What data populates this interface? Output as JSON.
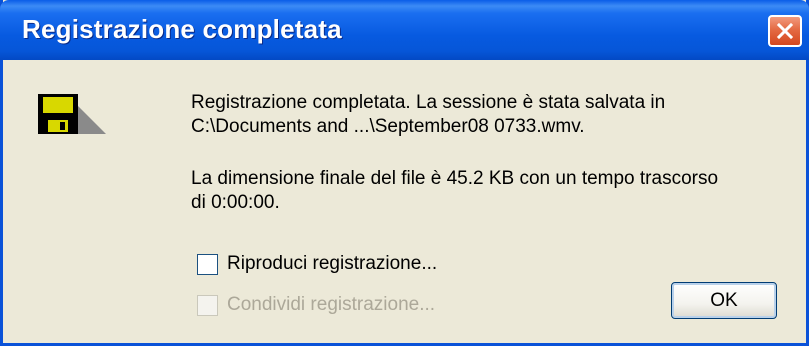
{
  "window": {
    "title": "Registrazione completata"
  },
  "icons": {
    "close": "close-icon",
    "save": "floppy-disk-icon"
  },
  "message": {
    "line1": "Registrazione completata. La sessione è stata salvata in",
    "line2": "C:\\Documents and ...\\September08 0733.wmv.",
    "line3": "La dimensione finale del file è 45.2 KB con un tempo trascorso",
    "line4": "di 0:00:00."
  },
  "options": {
    "play_label": "Riproduci registrazione...",
    "play_checked": false,
    "share_label": "Condividi registrazione...",
    "share_checked": false,
    "share_enabled": false
  },
  "buttons": {
    "ok_label": "OK"
  },
  "colors": {
    "titlebar": "#0a5de8",
    "close_button": "#e46a43",
    "dialog_background": "#ece9d8"
  }
}
